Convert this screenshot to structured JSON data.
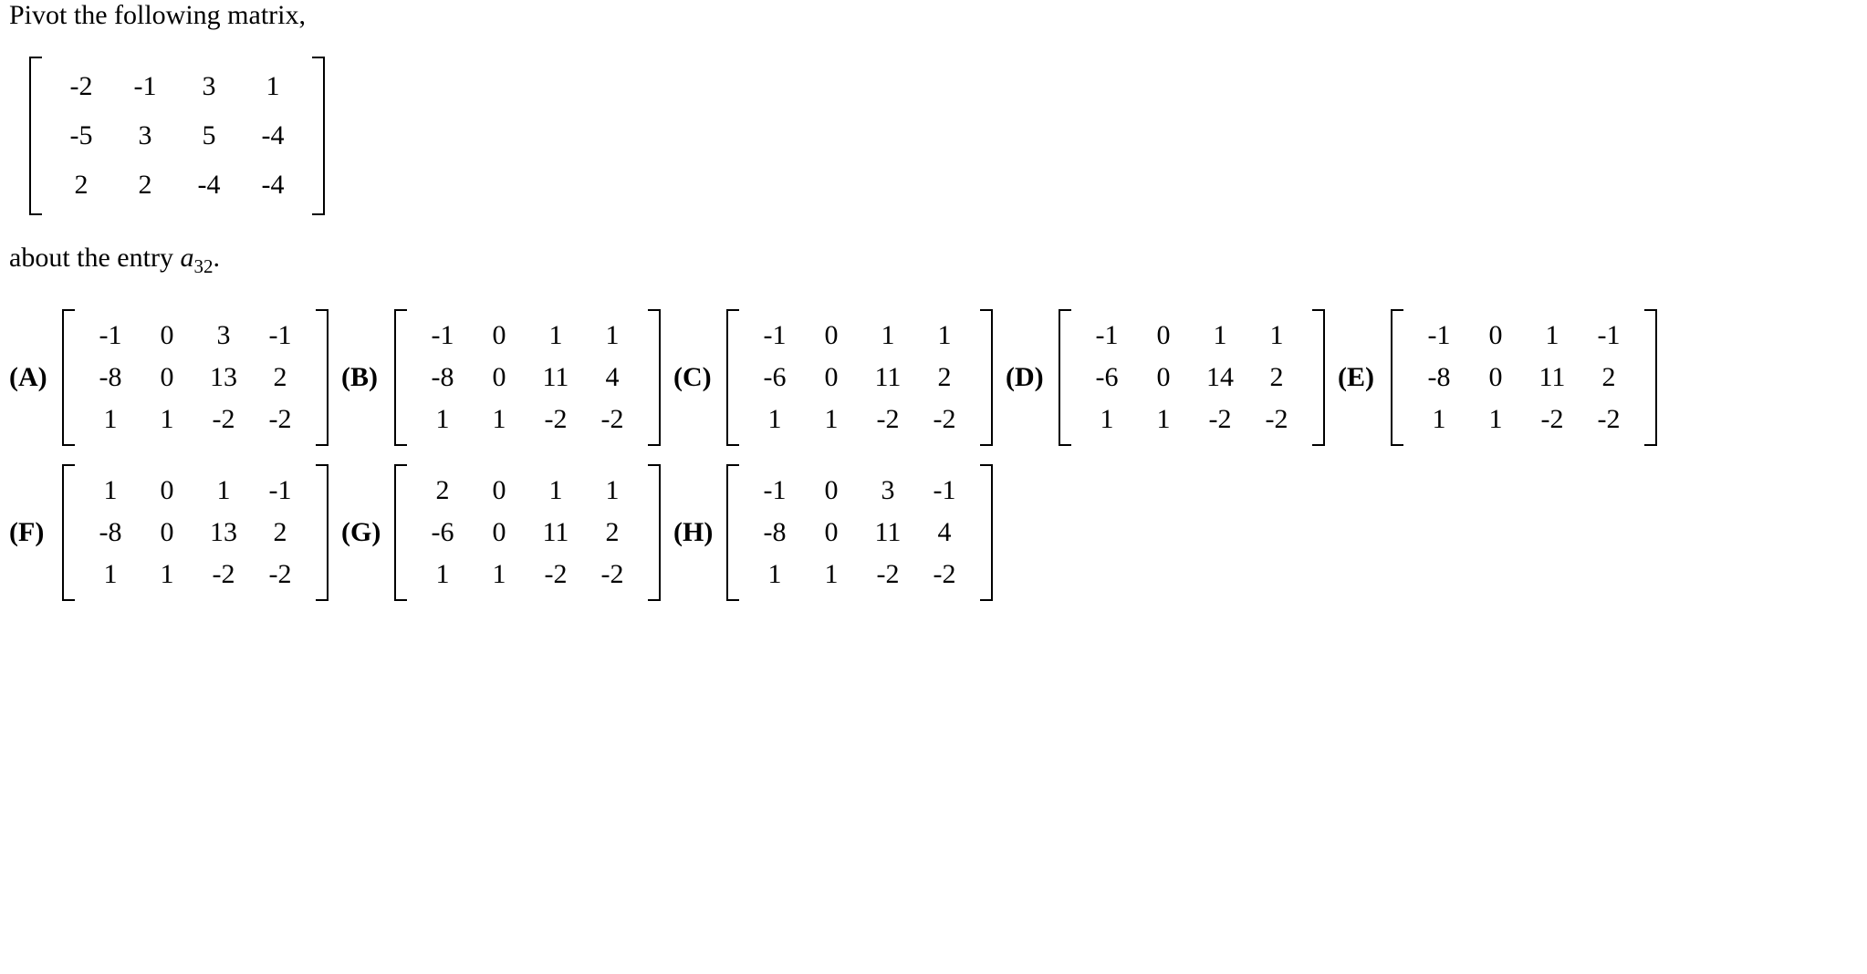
{
  "question": {
    "line1": "Pivot the following matrix,",
    "line2_prefix": "about the entry ",
    "line2_var": "a",
    "line2_sub": "32",
    "line2_suffix": "."
  },
  "main_matrix": [
    [
      "-2",
      "-1",
      "3",
      "1"
    ],
    [
      "-5",
      "3",
      "5",
      "-4"
    ],
    [
      "2",
      "2",
      "-4",
      "-4"
    ]
  ],
  "options": [
    {
      "label": "(A)",
      "matrix": [
        [
          "-1",
          "0",
          "3",
          "-1"
        ],
        [
          "-8",
          "0",
          "13",
          "2"
        ],
        [
          "1",
          "1",
          "-2",
          "-2"
        ]
      ]
    },
    {
      "label": "(B)",
      "matrix": [
        [
          "-1",
          "0",
          "1",
          "1"
        ],
        [
          "-8",
          "0",
          "11",
          "4"
        ],
        [
          "1",
          "1",
          "-2",
          "-2"
        ]
      ]
    },
    {
      "label": "(C)",
      "matrix": [
        [
          "-1",
          "0",
          "1",
          "1"
        ],
        [
          "-6",
          "0",
          "11",
          "2"
        ],
        [
          "1",
          "1",
          "-2",
          "-2"
        ]
      ]
    },
    {
      "label": "(D)",
      "matrix": [
        [
          "-1",
          "0",
          "1",
          "1"
        ],
        [
          "-6",
          "0",
          "14",
          "2"
        ],
        [
          "1",
          "1",
          "-2",
          "-2"
        ]
      ]
    },
    {
      "label": "(E)",
      "matrix": [
        [
          "-1",
          "0",
          "1",
          "-1"
        ],
        [
          "-8",
          "0",
          "11",
          "2"
        ],
        [
          "1",
          "1",
          "-2",
          "-2"
        ]
      ]
    },
    {
      "label": "(F)",
      "matrix": [
        [
          "1",
          "0",
          "1",
          "-1"
        ],
        [
          "-8",
          "0",
          "13",
          "2"
        ],
        [
          "1",
          "1",
          "-2",
          "-2"
        ]
      ]
    },
    {
      "label": "(G)",
      "matrix": [
        [
          "2",
          "0",
          "1",
          "1"
        ],
        [
          "-6",
          "0",
          "11",
          "2"
        ],
        [
          "1",
          "1",
          "-2",
          "-2"
        ]
      ]
    },
    {
      "label": "(H)",
      "matrix": [
        [
          "-1",
          "0",
          "3",
          "-1"
        ],
        [
          "-8",
          "0",
          "11",
          "4"
        ],
        [
          "1",
          "1",
          "-2",
          "-2"
        ]
      ]
    }
  ]
}
